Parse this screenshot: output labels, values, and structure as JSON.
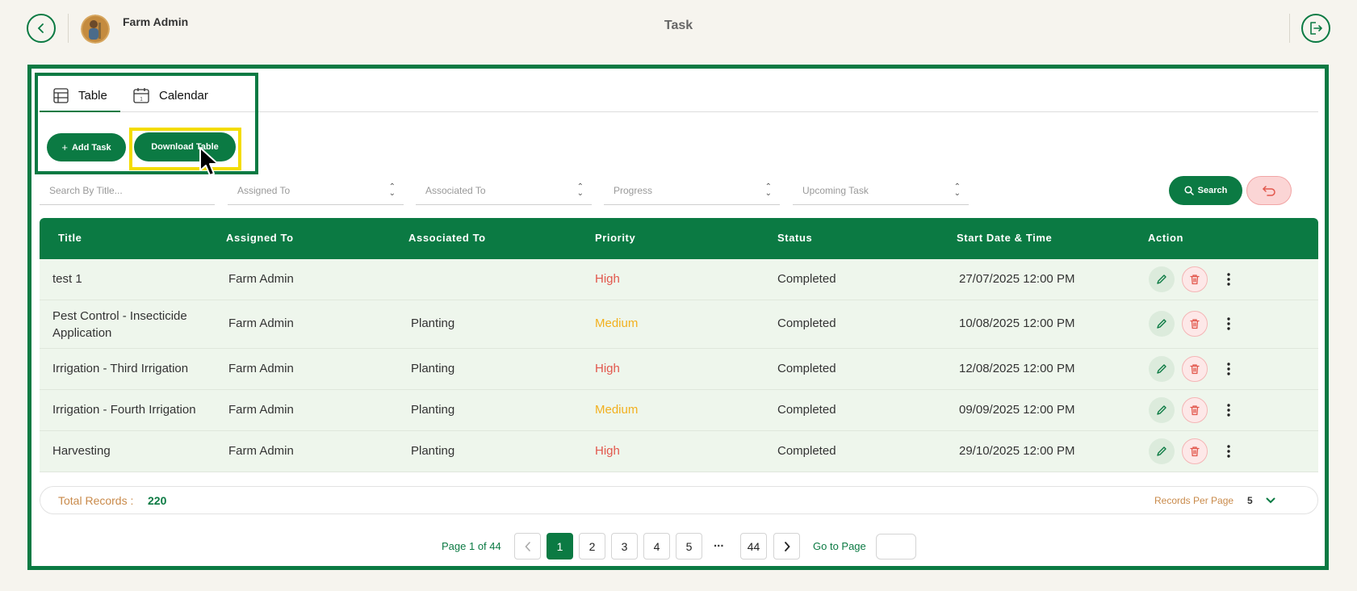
{
  "header": {
    "user_name": "Farm Admin",
    "page_title": "Task"
  },
  "tabs": [
    {
      "label": "Table",
      "icon": "table-icon",
      "active": true
    },
    {
      "label": "Calendar",
      "icon": "calendar-icon",
      "active": false
    }
  ],
  "actions": {
    "add_task": "Add Task",
    "download_table": "Download Table"
  },
  "filters": {
    "search_placeholder": "Search By Title...",
    "assigned_to": "Assigned To",
    "associated_to": "Associated To",
    "progress": "Progress",
    "upcoming_task": "Upcoming Task",
    "search_button": "Search"
  },
  "table": {
    "columns": [
      "Title",
      "Assigned To",
      "Associated To",
      "Priority",
      "Status",
      "Start Date & Time",
      "Action"
    ],
    "rows": [
      {
        "title": "test 1",
        "assigned": "Farm Admin",
        "associated": "",
        "priority": "High",
        "status": "Completed",
        "start": "27/07/2025 12:00 PM"
      },
      {
        "title": "Pest Control - Insecticide Application",
        "assigned": "Farm Admin",
        "associated": "Planting",
        "priority": "Medium",
        "status": "Completed",
        "start": "10/08/2025 12:00 PM"
      },
      {
        "title": "Irrigation - Third Irrigation",
        "assigned": "Farm Admin",
        "associated": "Planting",
        "priority": "High",
        "status": "Completed",
        "start": "12/08/2025 12:00 PM"
      },
      {
        "title": "Irrigation - Fourth Irrigation",
        "assigned": "Farm Admin",
        "associated": "Planting",
        "priority": "Medium",
        "status": "Completed",
        "start": "09/09/2025 12:00 PM"
      },
      {
        "title": "Harvesting",
        "assigned": "Farm Admin",
        "associated": "Planting",
        "priority": "High",
        "status": "Completed",
        "start": "29/10/2025 12:00 PM"
      }
    ]
  },
  "footer": {
    "total_label": "Total Records :",
    "total_value": "220",
    "per_page_label": "Records Per Page",
    "per_page_value": "5"
  },
  "pagination": {
    "page_info": "Page 1 of 44",
    "pages": [
      "1",
      "2",
      "3",
      "4",
      "5"
    ],
    "ellipsis": "...",
    "last_page": "44",
    "goto_label": "Go to Page",
    "goto_value": ""
  },
  "colors": {
    "brand": "#0b7a43",
    "priority_high": "#e2574c",
    "priority_medium": "#f2b01e",
    "highlight": "#f4dc00"
  }
}
